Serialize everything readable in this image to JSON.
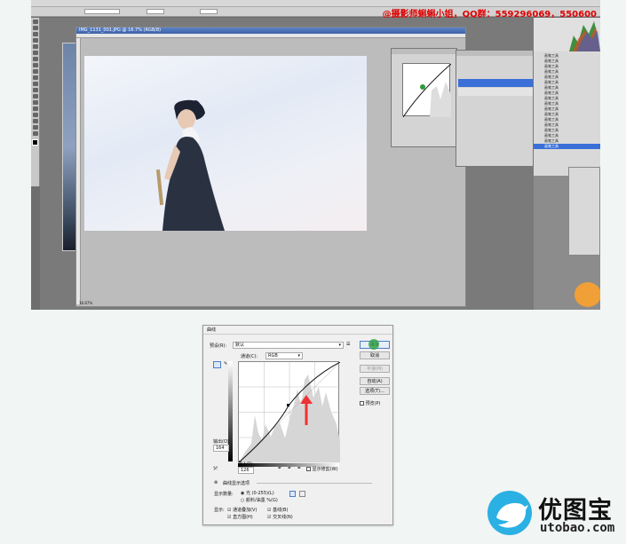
{
  "top": {
    "watermark": "@摄影师蝌蝌小姐，QQ群：559296069，550600",
    "doc_tab": "IMG_1131_001.JPG @ 16.7% (RGB/8)",
    "history_items": [
      "画笔工具",
      "画笔工具",
      "画笔工具",
      "画笔工具",
      "画笔工具",
      "画笔工具",
      "画笔工具",
      "画笔工具",
      "画笔工具",
      "画笔工具",
      "画笔工具",
      "画笔工具",
      "画笔工具",
      "画笔工具",
      "画笔工具",
      "画笔工具",
      "画笔工具",
      "画笔工具"
    ],
    "zoom": "16.67%",
    "colors": {
      "photo_sky": "#e8eef7",
      "dress": "#2a3242",
      "selection": "#3a6fd8",
      "watermark": "#e00000"
    }
  },
  "dialog": {
    "title": "曲线",
    "preset_label": "预设(R):",
    "preset_value": "默认",
    "channel_label": "通道(C):",
    "channel_value": "RGB",
    "buttons": {
      "ok": "确定",
      "cancel": "取消",
      "smooth": "平滑(M)",
      "auto": "自动(A)",
      "options": "选项(T)..."
    },
    "preview_label": "预览(P)",
    "output_label": "输出(O):",
    "output_value": "164",
    "input_label": "输入(I):",
    "input_value": "126",
    "show_clipping": "显示修剪(W)",
    "display_options_title": "曲线显示选项",
    "show_amount_label": "显示数量:",
    "light_option": "光 (0-255)(L)",
    "pigment_option": "颜料/油墨 %(G)",
    "show_label": "显示:",
    "checkboxes": [
      "通道叠加(V)",
      "直方图(H)",
      "基线(B)",
      "交叉线(N)"
    ]
  },
  "logo": {
    "brand": "优图宝",
    "url": "utobao.com",
    "color": "#2bb0e3"
  }
}
